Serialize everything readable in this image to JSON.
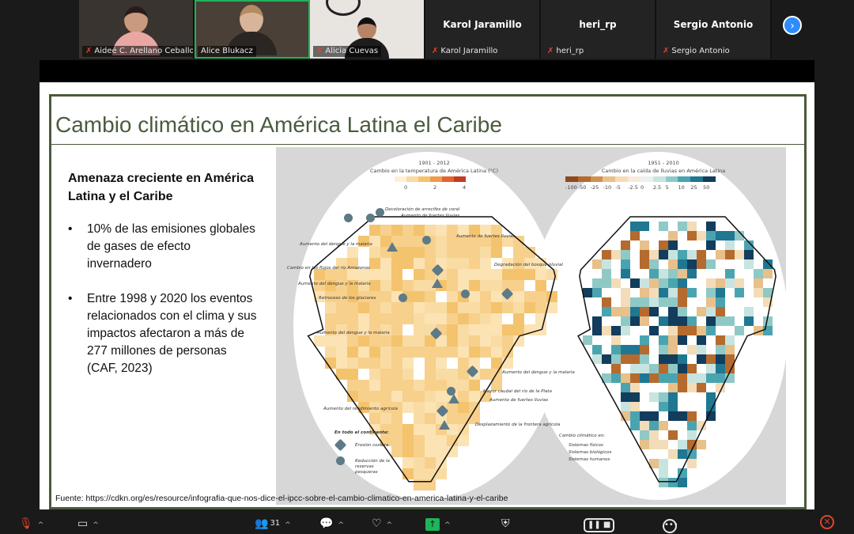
{
  "participants": {
    "video_tiles": [
      {
        "name": "Aideé C. Arellano Ceballos",
        "muted": true
      },
      {
        "name": "Alice Blukacz",
        "muted": false,
        "active": true
      },
      {
        "name": "Alicia Cuevas",
        "muted": true
      }
    ],
    "name_tiles": [
      {
        "display_name": "Karol Jaramillo",
        "name": "Karol Jaramillo",
        "muted": true
      },
      {
        "display_name": "heri_rp",
        "name": "heri_rp",
        "muted": true
      },
      {
        "display_name": "Sergio Antonio",
        "name": "Sergio Antonio",
        "muted": true
      }
    ],
    "next_page_icon": "chevron-right-icon"
  },
  "slide": {
    "title": "Cambio climático en América Latina el Caribe",
    "heading": "Amenaza creciente en América Latina y el Caribe",
    "bullets": [
      "10% de las emisiones globales de gases de efecto invernadero",
      "Entre 1998 y 2020 los eventos relacionados con el clima y sus impactos afectaron a más de 277 millones de personas (CAF, 2023)"
    ],
    "bullet_symbol": "•",
    "source": "Fuente: https://cdkn.org/es/resource/infografia-que-nos-dice-el-ipcc-sobre-el-cambio-climatico-en-america-latina-y-el-caribe",
    "infographic": {
      "left_map": {
        "period": "1901 - 2012",
        "legend_title": "Cambio en la temperatura de América Latina (°C)",
        "ticks": [
          "0",
          "2",
          "4"
        ],
        "colors": [
          "#fdf0d5",
          "#f9dca3",
          "#f4c36e",
          "#ee9b4d",
          "#e0652f",
          "#c23b22"
        ],
        "annotations": [
          "Decoloración de arrecifes de coral",
          "Aumento de fuertes lluvias",
          "Aumento del dengue y la malaria",
          "Aumento de fuertes lluvias",
          "Cambio en los flujos del río Amazonas",
          "Degradación del bosque pluvial",
          "Aumento del dengue y la malaria",
          "Retroceso de los glaciares",
          "Aumento del dengue y la malaria",
          "Aumento del dengue y la malaria",
          "Mayor caudal del río de la Plata",
          "Aumento de fuertes lluvias",
          "Aumento del rendimiento agrícola",
          "Desplazamiento de la frontera agrícola"
        ],
        "key_title": "En todo el continente:",
        "key_items": [
          "Erosión costera",
          "Reducción de la reservas pesqueras"
        ]
      },
      "right_map": {
        "period": "1951 - 2010",
        "legend_title": "Cambio en la caída de lluvias en América Latina",
        "ticks": [
          "-100",
          "-50",
          "-25",
          "-10",
          "-5",
          "-2.5",
          "0",
          "2.5",
          "5",
          "10",
          "25",
          "50"
        ],
        "colors": [
          "#8c4a1e",
          "#b56a2e",
          "#d09050",
          "#e8c08a",
          "#f3dcb8",
          "#f7ecd9",
          "#e9f2f0",
          "#c8e4e0",
          "#8fc9c6",
          "#4aa4b0",
          "#1f7792",
          "#123d5c"
        ],
        "key_title": "Cambio climático en:",
        "key_items": [
          "Sistemas físicos",
          "Sistemas biológicos",
          "Sistemas humanos"
        ]
      }
    }
  },
  "toolbar": {
    "items": [
      {
        "icon": "mic-muted-icon"
      },
      {
        "icon": "video-camera-icon"
      },
      {
        "icon": "participants-icon",
        "count": "31"
      },
      {
        "icon": "chat-icon"
      },
      {
        "icon": "reactions-icon"
      },
      {
        "icon": "share-screen-icon"
      },
      {
        "icon": "security-icon"
      },
      {
        "icon": "record-icon"
      },
      {
        "icon": "more-icon"
      },
      {
        "icon": "leave-icon"
      }
    ],
    "caret": "^"
  },
  "colors": {
    "accent_green": "#1fb35a",
    "mute_red": "#e0452f",
    "title_green": "#4b5b3f",
    "zoom_blue": "#2d8cff"
  }
}
